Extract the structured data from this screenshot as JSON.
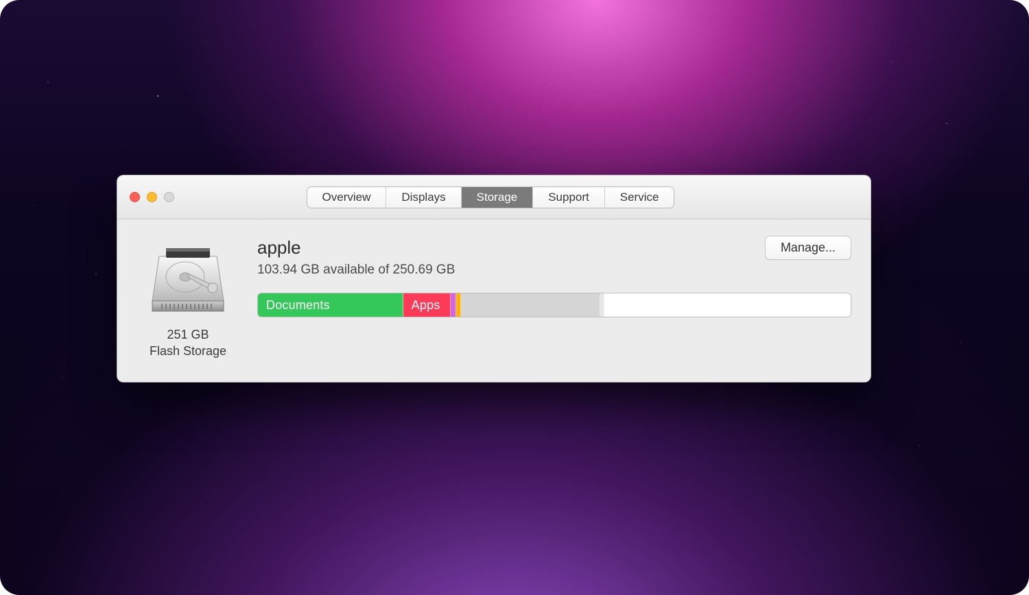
{
  "tabs": [
    {
      "label": "Overview",
      "active": false
    },
    {
      "label": "Displays",
      "active": false
    },
    {
      "label": "Storage",
      "active": true
    },
    {
      "label": "Support",
      "active": false
    },
    {
      "label": "Service",
      "active": false
    }
  ],
  "drive": {
    "capacity_label": "251 GB",
    "type_label": "Flash Storage"
  },
  "disk": {
    "name": "apple",
    "available_label": "103.94 GB available of 250.69 GB",
    "manage_label": "Manage..."
  },
  "storage_segments": [
    {
      "name": "documents",
      "label": "Documents",
      "color": "#34c759",
      "percent": 24.5
    },
    {
      "name": "apps",
      "label": "Apps",
      "color": "#ff3b57",
      "percent": 8.0
    },
    {
      "name": "purple",
      "label": "",
      "color": "#d465e0",
      "percent": 1.0
    },
    {
      "name": "orange",
      "label": "",
      "color": "#ffb300",
      "percent": 0.8
    },
    {
      "name": "system",
      "label": "",
      "color": "#d5d5d5",
      "percent": 23.5
    },
    {
      "name": "tiny",
      "label": "",
      "color": "#e6e6e6",
      "percent": 0.7
    },
    {
      "name": "free",
      "label": "",
      "color": "#ffffff",
      "percent": 41.5
    }
  ]
}
